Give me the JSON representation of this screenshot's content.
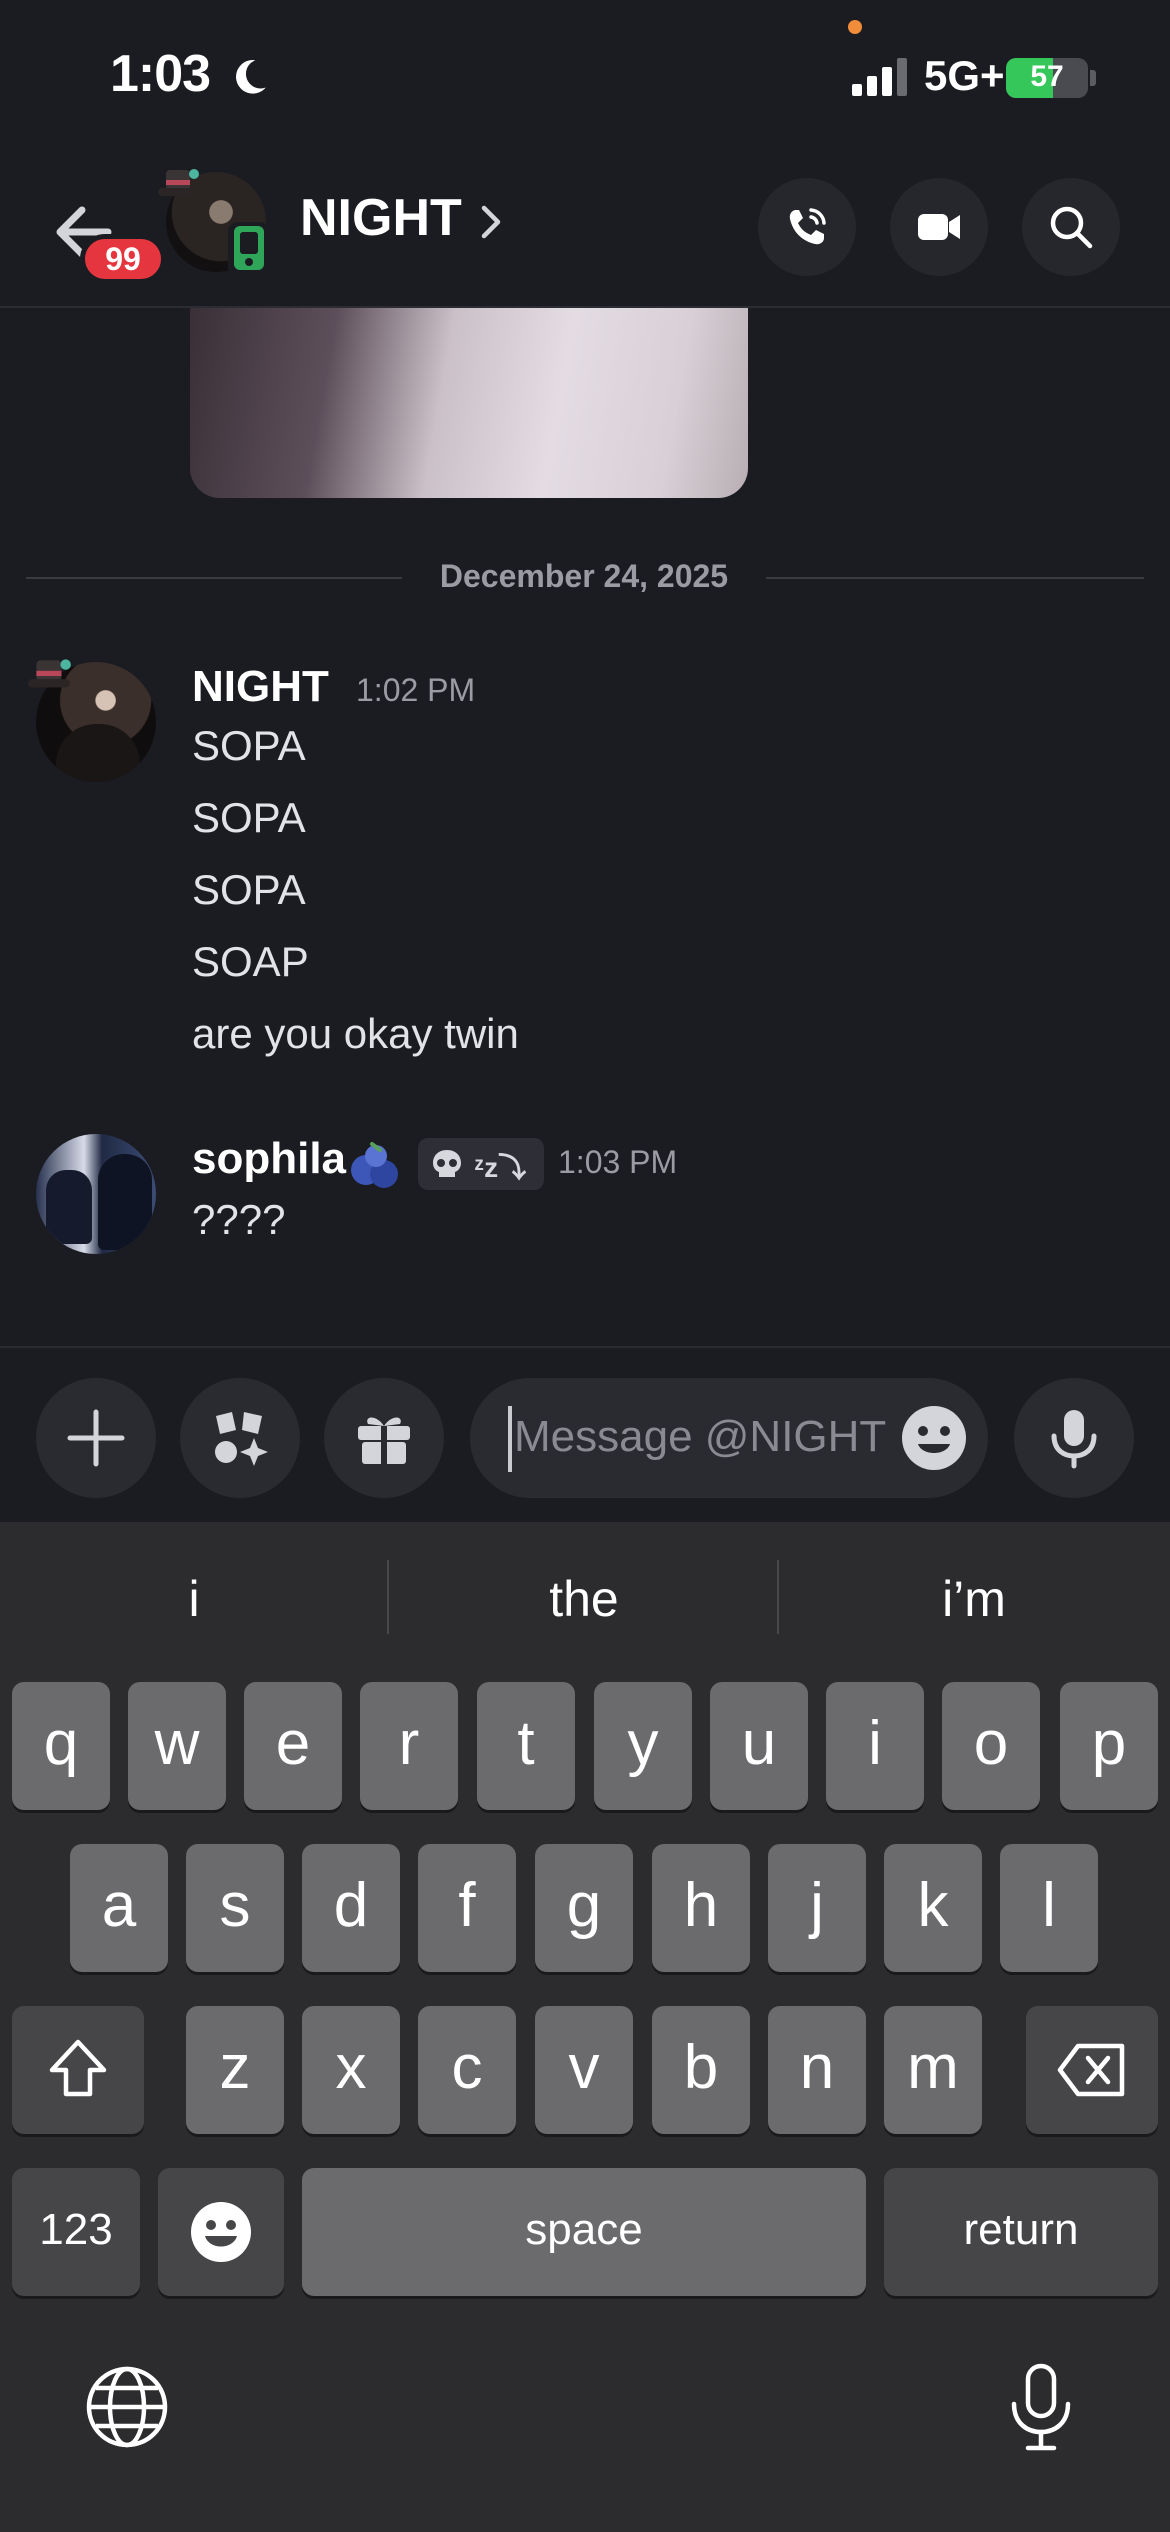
{
  "status_bar": {
    "time": "1:03",
    "network": "5G+",
    "battery_percent": 57,
    "battery_label": "57"
  },
  "header": {
    "unread_badge": "99",
    "channel_name": "NIGHT"
  },
  "date_divider": "December 24, 2025",
  "messages": [
    {
      "author": "NIGHT",
      "time": "1:02 PM",
      "lines": [
        "SOPA",
        "SOPA",
        "SOPA",
        "SOAP",
        "are you okay twin"
      ]
    },
    {
      "author": "sophila",
      "time": "1:03 PM",
      "tag": "ᶻz⤵",
      "lines": [
        "????"
      ]
    }
  ],
  "composer": {
    "placeholder": "Message @NIGHT"
  },
  "keyboard": {
    "suggestions": [
      "i",
      "the",
      "i’m"
    ],
    "row1": [
      "q",
      "w",
      "e",
      "r",
      "t",
      "y",
      "u",
      "i",
      "o",
      "p"
    ],
    "row2": [
      "a",
      "s",
      "d",
      "f",
      "g",
      "h",
      "j",
      "k",
      "l"
    ],
    "row3": [
      "z",
      "x",
      "c",
      "v",
      "b",
      "n",
      "m"
    ],
    "numbers_label": "123",
    "space_label": "space",
    "return_label": "return"
  },
  "colors": {
    "background": "#1b1c21",
    "badge": "#e5363f",
    "online_mobile": "#2fa55a",
    "battery": "#35c759"
  }
}
